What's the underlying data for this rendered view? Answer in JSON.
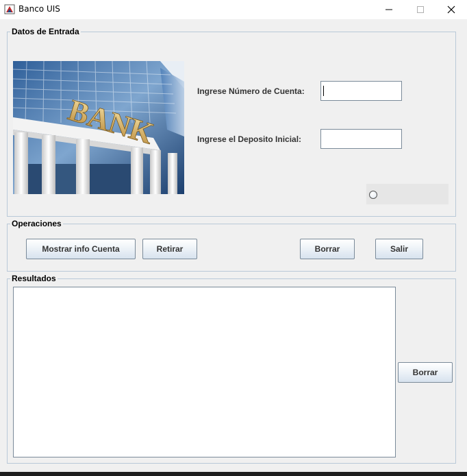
{
  "window": {
    "title": "Banco UIS",
    "icons": {
      "app": "java-app-icon",
      "minimize": "minimize-icon",
      "maximize": "maximize-icon",
      "close": "close-icon"
    }
  },
  "datos_entrada": {
    "title": "Datos de Entrada",
    "image_text": "BANK",
    "account_label": "Ingrese Número de Cuenta:",
    "account_value": "",
    "deposit_label": "Ingrese el Deposito Inicial:",
    "deposit_value": ""
  },
  "operaciones": {
    "title": "Operaciones",
    "buttons": {
      "mostrar_info": "Mostrar info Cuenta",
      "retirar": "Retirar",
      "borrar": "Borrar",
      "salir": "Salir"
    }
  },
  "resultados": {
    "title": "Resultados",
    "text": "",
    "borrar": "Borrar"
  },
  "colors": {
    "background": "#f0f0f0",
    "border": "#b9c9d8",
    "button_border": "#7a8a99"
  }
}
